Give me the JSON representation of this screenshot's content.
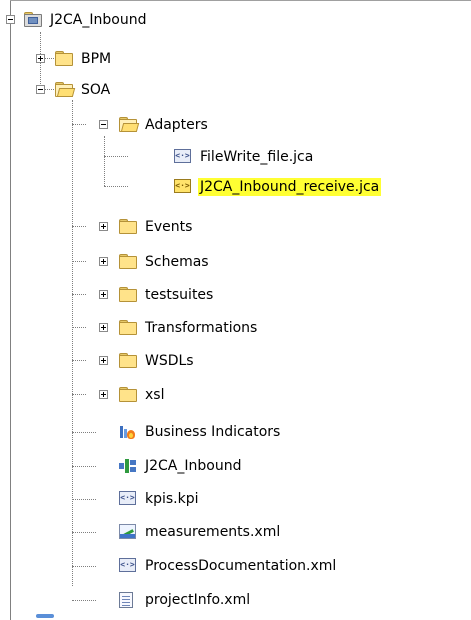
{
  "tree": {
    "root": {
      "label": "J2CA_Inbound",
      "icon": "project-folder-icon",
      "expanded": true
    },
    "items": [
      {
        "label": "BPM",
        "icon": "folder-icon",
        "expanded": false
      },
      {
        "label": "SOA",
        "icon": "folder-open-icon",
        "expanded": true
      },
      {
        "label": "Adapters",
        "icon": "folder-open-icon",
        "expanded": true
      },
      {
        "label": "FileWrite_file.jca",
        "icon": "jca-file-icon"
      },
      {
        "label": "J2CA_Inbound_receive.jca",
        "icon": "jca-file-icon",
        "selected": true
      },
      {
        "label": "Events",
        "icon": "folder-icon",
        "expanded": false
      },
      {
        "label": "Schemas",
        "icon": "folder-icon",
        "expanded": false
      },
      {
        "label": "testsuites",
        "icon": "folder-icon",
        "expanded": false
      },
      {
        "label": "Transformations",
        "icon": "folder-icon",
        "expanded": false
      },
      {
        "label": "WSDLs",
        "icon": "folder-icon",
        "expanded": false
      },
      {
        "label": "xsl",
        "icon": "folder-icon",
        "expanded": false
      },
      {
        "label": "Business Indicators",
        "icon": "business-indicators-icon"
      },
      {
        "label": "J2CA_Inbound",
        "icon": "composite-icon"
      },
      {
        "label": "kpis.kpi",
        "icon": "kpi-file-icon"
      },
      {
        "label": "measurements.xml",
        "icon": "measurements-chart-icon"
      },
      {
        "label": "ProcessDocumentation.xml",
        "icon": "xml-file-icon"
      },
      {
        "label": "projectInfo.xml",
        "icon": "document-icon"
      }
    ]
  },
  "colors": {
    "selection": "#ffff33",
    "tree_lines": "#7f7f7f",
    "folder": "#ffe38a"
  }
}
